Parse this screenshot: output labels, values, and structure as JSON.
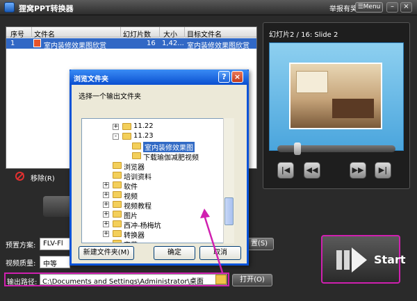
{
  "window": {
    "title": "狸窝PPT转换器",
    "report_label": "举报有奖",
    "menu_label": "Menu"
  },
  "table": {
    "columns": [
      "序号",
      "文件名",
      "幻灯片数",
      "大小",
      "目标文件名"
    ],
    "rows": [
      {
        "index": "1",
        "file_name": "室内装修效果图欣赏",
        "slides": "16",
        "size": "1,42...",
        "target": "室内装修效果图欣赏"
      }
    ]
  },
  "remove_label": "移除(R)",
  "preview": {
    "slide_info": "幻灯片2 / 16: Slide 2",
    "progress": 0.15
  },
  "form": {
    "preset_label": "预置方案:",
    "preset_value": "FLV-Fl",
    "preset_side_label": "置(S)",
    "quality_label": "视频质量:",
    "quality_value": "中等",
    "path_label": "输出路径:",
    "path_value": "C:\\Documents and Settings\\Administrator\\桌面",
    "open_label": "打开(O)"
  },
  "start_label": "Start",
  "dialog": {
    "title": "浏览文件夹",
    "prompt": "选择一个输出文件夹",
    "tree": [
      {
        "label": "11.22",
        "level": 2,
        "expander": "+"
      },
      {
        "label": "11.23",
        "level": 2,
        "expander": "-"
      },
      {
        "label": "室内装修效果图",
        "level": 3,
        "selected": true
      },
      {
        "label": "下载瑜伽减肥视频",
        "level": 3
      },
      {
        "label": "浏览器",
        "level": 1
      },
      {
        "label": "培训资料",
        "level": 1
      },
      {
        "label": "软件",
        "level": 1,
        "expander": "+"
      },
      {
        "label": "视频",
        "level": 1,
        "expander": "+"
      },
      {
        "label": "视频教程",
        "level": 1,
        "expander": "+"
      },
      {
        "label": "图片",
        "level": 1,
        "expander": "+"
      },
      {
        "label": "西冲-杨梅坑",
        "level": 1,
        "expander": "+"
      },
      {
        "label": "转换器",
        "level": 1,
        "expander": "+"
      },
      {
        "label": "宇幕",
        "level": 1
      }
    ],
    "new_folder_label": "新建文件夹(M)",
    "ok_label": "确定",
    "cancel_label": "取消"
  }
}
